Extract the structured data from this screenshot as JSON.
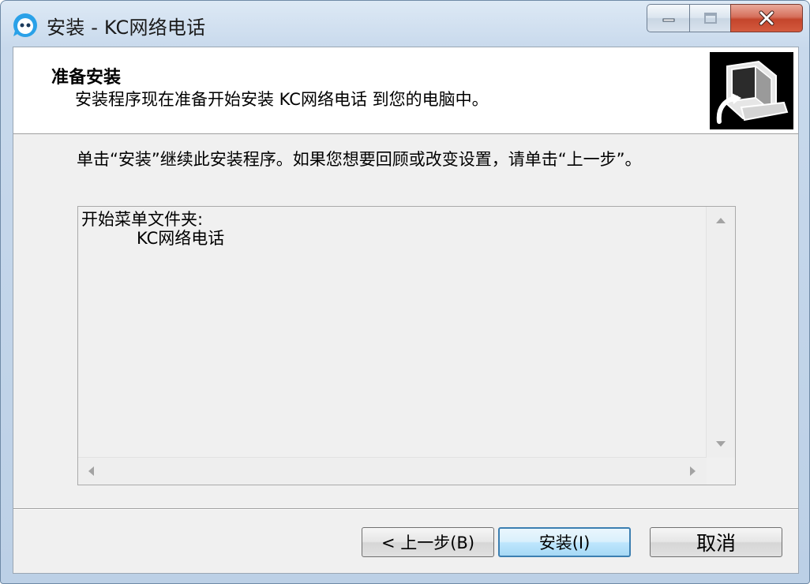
{
  "window": {
    "title": "安装 - KC网络电话",
    "controls": {
      "minimize": "minimize-icon",
      "maximize": "maximize-icon",
      "close": "close-icon"
    }
  },
  "header": {
    "title": "准备安装",
    "subtitle": "安装程序现在准备开始安装 KC网络电话 到您的电脑中。",
    "image": "computer-install-icon"
  },
  "body": {
    "intro": "单击“安装”继续此安装程序。如果您想要回顾或改变设置，请单击“上一步”。",
    "memo": {
      "line1": "开始菜单文件夹:",
      "line2": "KC网络电话"
    }
  },
  "buttons": {
    "back": "< 上一步(B)",
    "install": "安装(I)",
    "cancel": "取消"
  },
  "colors": {
    "accent": "#3c7fb1",
    "title_bar": "#c8d9ec",
    "close": "#c4452c"
  }
}
